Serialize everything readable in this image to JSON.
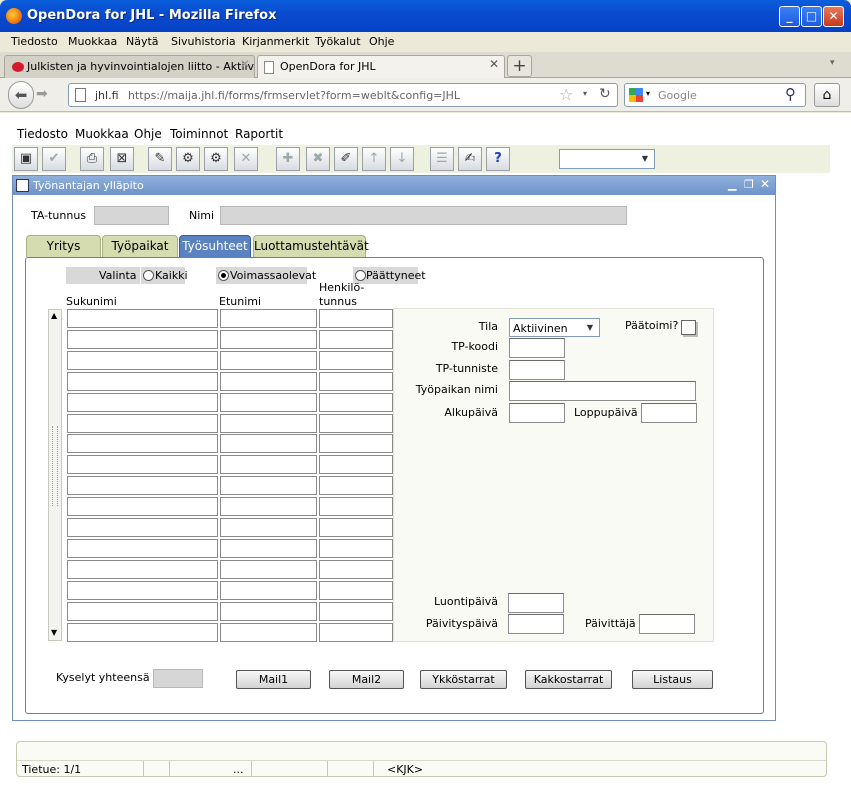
{
  "window": {
    "title": "OpenDora for JHL - Mozilla Firefox"
  },
  "browser_menu": [
    "Tiedosto",
    "Muokkaa",
    "Näytä",
    "Sivuhistoria",
    "Kirjanmerkit",
    "Työkalut",
    "Ohje"
  ],
  "tabs": [
    {
      "label": "Julkisten ja hyvinvointialojen liitto - Aktiivit"
    },
    {
      "label": "OpenDora for JHL"
    }
  ],
  "new_tab": "+",
  "nav": {
    "domain": "jhl.fi",
    "url": "https://maija.jhl.fi/forms/frmservlet?form=weblt&config=JHL",
    "search_placeholder": "Google"
  },
  "forms_menu": [
    "Tiedosto",
    "Muokkaa",
    "Ohje",
    "Toiminnot",
    "Raportit"
  ],
  "form": {
    "title": "Työnantajan ylläpito",
    "ta_tunnus_label": "TA-tunnus",
    "ta_tunnus_value": "",
    "nimi_label": "Nimi",
    "nimi_value": "",
    "tabs": [
      "Yritys",
      "Työpaikat",
      "Työsuhteet",
      "Luottamustehtävät"
    ],
    "active_tab": "Työsuhteet",
    "filter": {
      "valinta": "Valinta",
      "kaikki": "Kaikki",
      "voimassaolevat": "Voimassaolevat",
      "paattyneet": "Päättyneet"
    },
    "columns": {
      "sukunimi": "Sukunimi",
      "etunimi": "Etunimi",
      "henkilo1": "Henkilö-",
      "henkilo2": "tunnus"
    },
    "detail": {
      "tila_label": "Tila",
      "tila_value": "Aktiivinen",
      "paatoimi_label": "Päätoimi?",
      "tp_koodi_label": "TP-koodi",
      "tp_tunniste_label": "TP-tunniste",
      "tyopaikan_nimi_label": "Työpaikan nimi",
      "alkupaiva_label": "Alkupäivä",
      "loppupaiva_label": "Loppupäivä",
      "luontipaiva_label": "Luontipäivä",
      "paivityspaiva_label": "Päivityspäivä",
      "paivittaja_label": "Päivittäjä"
    },
    "kyselyt_label": "Kyselyt yhteensä",
    "buttons": [
      "Mail1",
      "Mail2",
      "Ykköstarrat",
      "Kakkostarrat",
      "Listaus"
    ]
  },
  "status": {
    "record": "Tietue: 1/1",
    "dots": "...",
    "mode": "<KJK>"
  }
}
